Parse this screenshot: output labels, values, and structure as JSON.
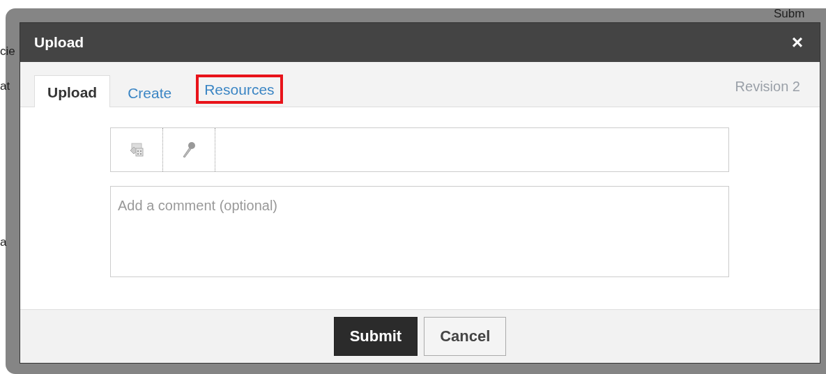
{
  "background": {
    "fragments": [
      {
        "text": "cie"
      },
      {
        "text": "at"
      },
      {
        "text": "a"
      },
      {
        "text": "Subm"
      }
    ]
  },
  "dialog": {
    "title": "Upload",
    "close": "×"
  },
  "tabs": [
    {
      "label": "Upload",
      "selected": true,
      "highlighted": false
    },
    {
      "label": "Create",
      "selected": false,
      "highlighted": false
    },
    {
      "label": "Resources",
      "selected": false,
      "highlighted": true
    }
  ],
  "revision": "Revision 2",
  "comment": {
    "placeholder": "Add a comment (optional)"
  },
  "buttons": [
    {
      "label": "Submit",
      "kind": "primary"
    },
    {
      "label": "Cancel",
      "kind": "secondary"
    }
  ]
}
